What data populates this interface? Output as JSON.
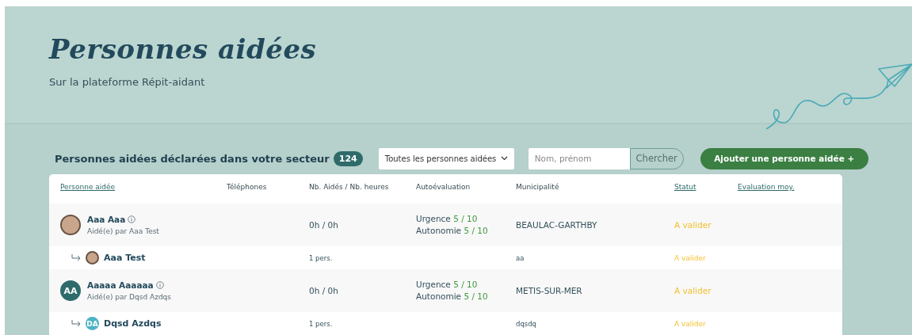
{
  "header": {
    "title": "Personnes aidées",
    "subtitle": "Sur la plateforme Répit-aidant"
  },
  "toolbar": {
    "heading": "Personnes aidées déclarées dans votre secteur",
    "count": "124",
    "filter": "Toutes les personnes aidées",
    "search": {
      "placeholder": "Nom, prénom",
      "button": "Chercher"
    },
    "add_button": "Ajouter une personne aidée +"
  },
  "table": {
    "columns": [
      {
        "label": "Personne aidée",
        "sortable": true
      },
      {
        "label": "Téléphones",
        "sortable": false
      },
      {
        "label": "Nb. Aidés / Nb. heures",
        "sortable": false
      },
      {
        "label": "Autoévaluation",
        "sortable": false
      },
      {
        "label": "Municipalité",
        "sortable": false
      },
      {
        "label": "Statut",
        "sortable": true
      },
      {
        "label": "Evaluation moy.",
        "sortable": true
      }
    ],
    "rows": [
      {
        "kind": "main",
        "avatar": {
          "kind": "photo"
        },
        "name": "Aaa Aaa",
        "helper": "Aidé(e) par Aaa Test",
        "hours": "0h / 0h",
        "evaluation": [
          {
            "label": "Urgence",
            "score": "5 / 10"
          },
          {
            "label": "Autonomie",
            "score": "5 / 10"
          }
        ],
        "municipality": "BEAULAC-GARTHBY",
        "status": "A valider"
      },
      {
        "kind": "sub",
        "avatar": {
          "kind": "photo"
        },
        "name": "Aaa Test",
        "hours": "1 pers.",
        "municipality": "aa",
        "status": "A valider"
      },
      {
        "kind": "main",
        "avatar": {
          "kind": "initials",
          "initials": "AA",
          "color": "#2e6b6a"
        },
        "name": "Aaaaa Aaaaaa",
        "helper": "Aidé(e) par Dqsd Azdqs",
        "hours": "0h / 0h",
        "evaluation": [
          {
            "label": "Urgence",
            "score": "5 / 10"
          },
          {
            "label": "Autonomie",
            "score": "5 / 10"
          }
        ],
        "municipality": "METIS-SUR-MER",
        "status": "A valider"
      },
      {
        "kind": "sub",
        "avatar": {
          "kind": "initials",
          "initials": "DA",
          "color": "#4bb3c4"
        },
        "name": "Dqsd Azdqs",
        "hours": "1 pers.",
        "municipality": "dqsdq",
        "status": "A valider"
      }
    ]
  }
}
